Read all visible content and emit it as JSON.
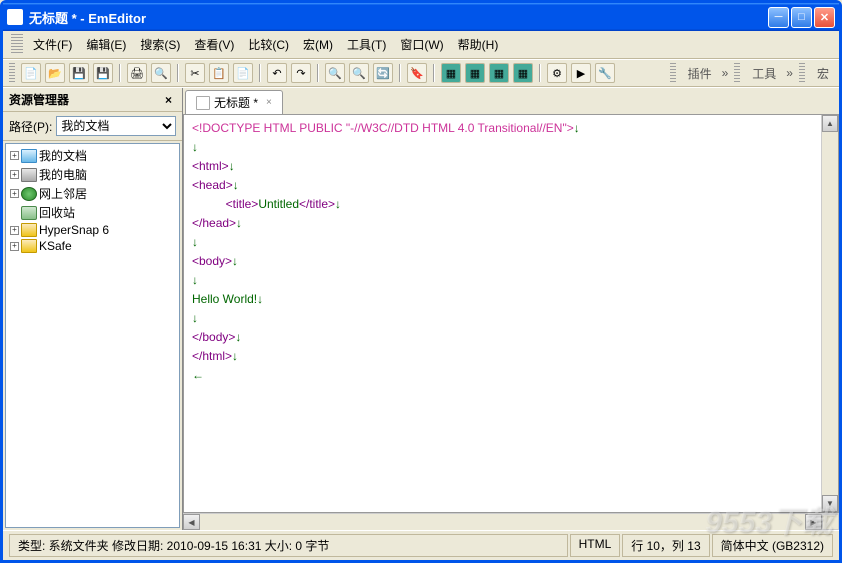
{
  "window": {
    "title": "无标题 * - EmEditor"
  },
  "menu": {
    "file": "文件(F)",
    "edit": "编辑(E)",
    "search": "搜索(S)",
    "view": "查看(V)",
    "compare": "比较(C)",
    "macro": "宏(M)",
    "tools": "工具(T)",
    "window": "窗口(W)",
    "help": "帮助(H)"
  },
  "toolbar_right": {
    "plugins": "插件",
    "tools": "工具",
    "macro": "宏"
  },
  "sidebar": {
    "title": "资源管理器",
    "path_label": "路径(P):",
    "path_value": "我的文档",
    "items": [
      {
        "label": "我的文档",
        "icon": "docs"
      },
      {
        "label": "我的电脑",
        "icon": "pc"
      },
      {
        "label": "网上邻居",
        "icon": "net"
      },
      {
        "label": "回收站",
        "icon": "recycle"
      },
      {
        "label": "HyperSnap 6",
        "icon": "folder"
      },
      {
        "label": "KSafe",
        "icon": "folder"
      }
    ]
  },
  "tab": {
    "label": "无标题 *"
  },
  "editor": {
    "doctype_open": "<!",
    "doctype_inner": "DOCTYPE HTML PUBLIC \"-//W3C//DTD HTML 4.0 Transitional//EN\"",
    "doctype_close": ">",
    "html_open": "<html>",
    "head_open": "<head>",
    "title_open": "<title>",
    "title_text": "Untitled",
    "title_close": "</title>",
    "head_close": "</head>",
    "body_open": "<body>",
    "hello": "Hello World!",
    "body_close": "</body>",
    "html_close": "</html>",
    "eol": "↓",
    "eof": "←",
    "indent": "    "
  },
  "status": {
    "left": "类型:  系统文件夹  修改日期:  2010-09-15 16:31  大小:  0 字节",
    "html": "HTML",
    "pos": "行 10，列 13",
    "encoding": "简体中文 (GB2312)"
  },
  "watermark": "9553下载"
}
